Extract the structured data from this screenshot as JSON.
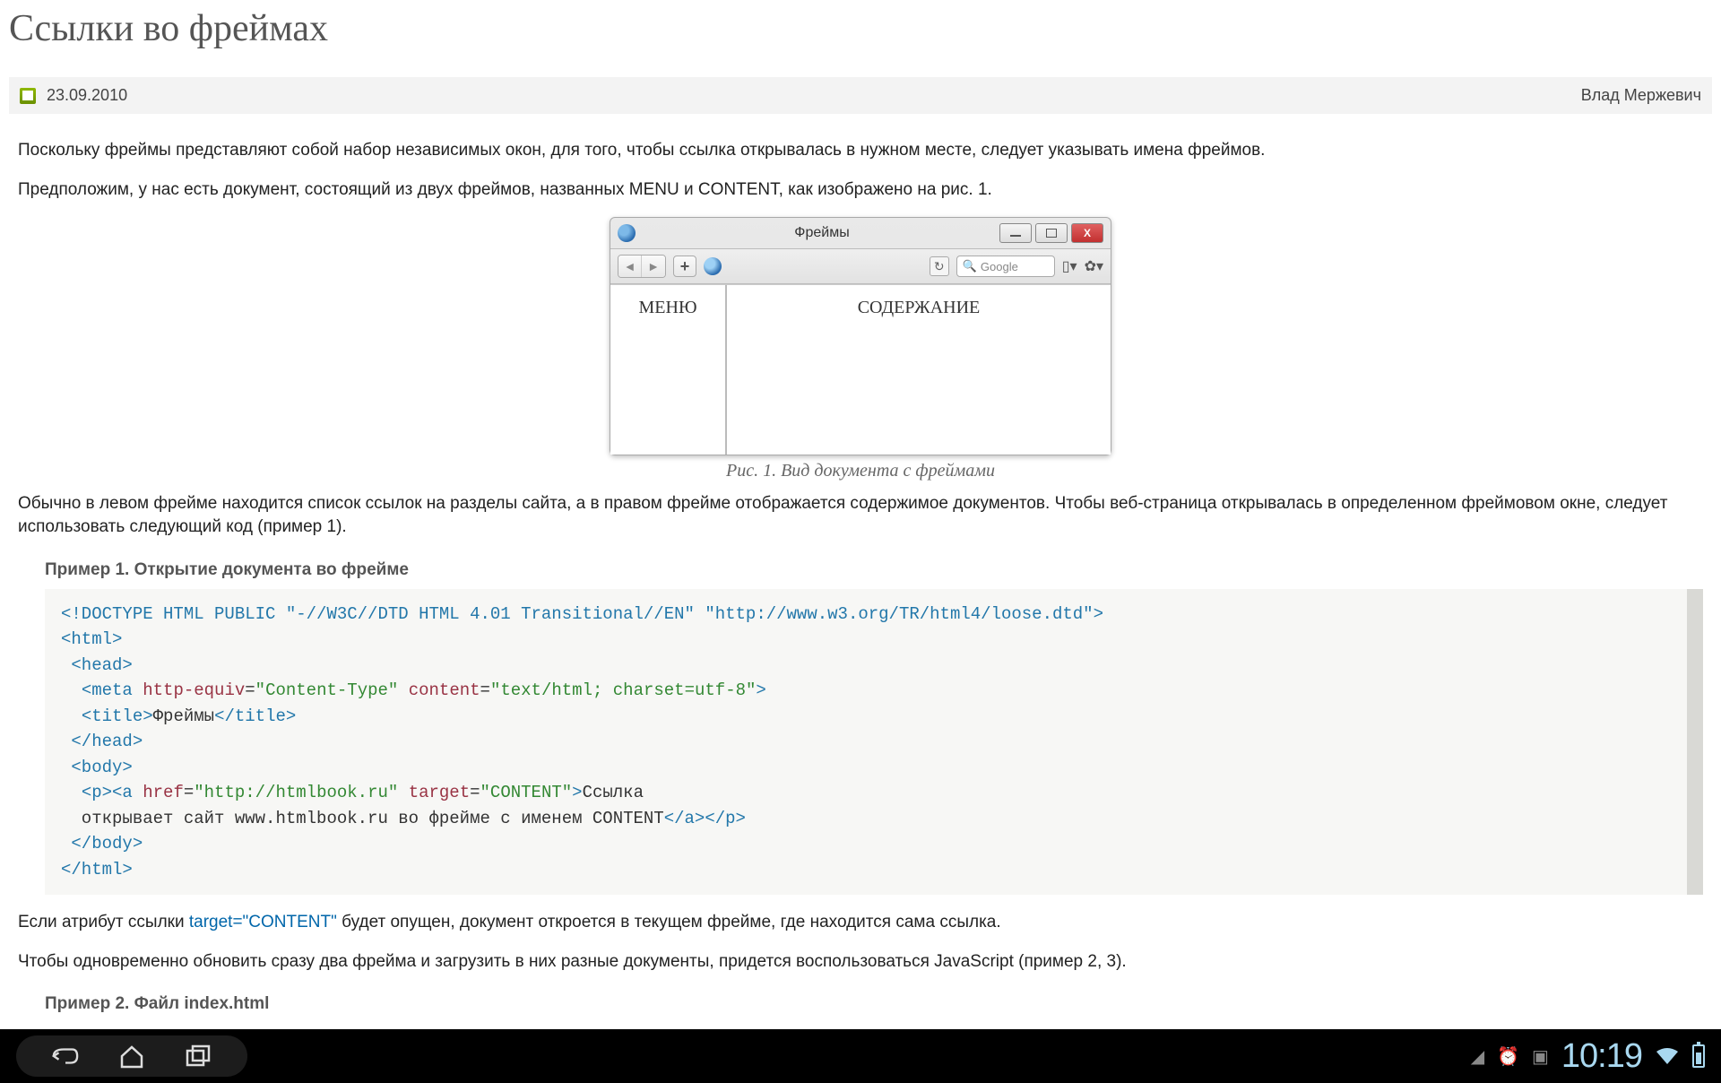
{
  "title": "Ссылки во фреймах",
  "meta": {
    "date": "23.09.2010",
    "author": "Влад Мержевич"
  },
  "p1": "Поскольку фреймы представляют собой набор независимых окон, для того, чтобы ссылка открывалась в нужном месте, следует указывать имена фреймов.",
  "p2": "Предположим, у нас есть документ, состоящий из двух фреймов, названных MENU и CONTENT, как изображено на рис. 1.",
  "browser": {
    "title": "Фреймы",
    "search_placeholder": "Google",
    "frame_left": "МЕНЮ",
    "frame_right": "СОДЕРЖАНИЕ"
  },
  "caption": "Рис. 1. Вид документа с фреймами",
  "p3": "Обычно в левом фрейме находится список ссылок на разделы сайта, а в правом фрейме отображается содержимое документов. Чтобы веб-страница открывалась в определенном фреймовом окне, следует использовать следующий код (пример 1).",
  "example1_title": "Пример 1. Открытие документа во фрейме",
  "code1": {
    "doctype": "<!DOCTYPE HTML PUBLIC \"-//W3C//DTD HTML 4.01 Transitional//EN\" \"http://www.w3.org/TR/html4/loose.dtd\">",
    "meta_attr_he": "http-equiv",
    "meta_val_he": "\"Content-Type\"",
    "meta_attr_c": "content",
    "meta_val_c": "\"text/html; charset=utf-8\"",
    "title_text": "Фреймы",
    "a_href_attr": "href",
    "a_href_val": "\"http://htmlbook.ru\"",
    "a_target_attr": "target",
    "a_target_val": "\"CONTENT\"",
    "a_text1": "Ссылка",
    "a_text2": "  открывает сайт www.htmlbook.ru во фрейме с именем CONTENT"
  },
  "p4_pre": "Если атрибут ссылки ",
  "p4_attr": "target=\"CONTENT\"",
  "p4_post": " будет опущен, документ откроется в текущем фрейме, где находится сама ссылка.",
  "p5": "Чтобы одновременно обновить сразу два фрейма и загрузить в них разные документы, придется воспользоваться JavaScript (пример 2, 3).",
  "example2_title": "Пример 2. Файл index.html",
  "statusbar": {
    "time": "10:19"
  }
}
